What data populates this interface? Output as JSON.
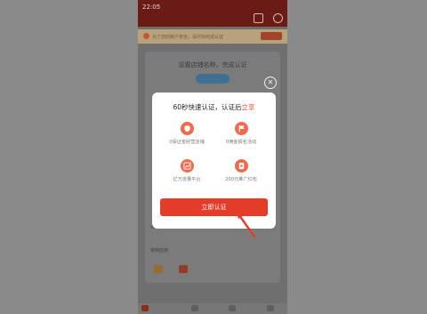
{
  "status_bar": {
    "time": "22:05"
  },
  "background": {
    "notice_text": "为了您的账户安全，请尽快完成认证",
    "heading": "设置店铺名称，完成认证",
    "link_row": "1分钟认证流程",
    "section_title": "常用应用"
  },
  "dialog": {
    "title_prefix": "60秒快速认证，认证后",
    "title_accent": "立享",
    "features": [
      {
        "label": "0保证金经营店铺",
        "icon": "shield-icon"
      },
      {
        "label": "0佣金报名活动",
        "icon": "flag-icon"
      },
      {
        "label": "亿万流量平台",
        "icon": "trend-chart-icon"
      },
      {
        "label": "200元推广红包",
        "icon": "red-packet-icon"
      }
    ],
    "cta_label": "立即认证"
  },
  "colors": {
    "accent": "#e53b29",
    "icon_bg": "#f06a4b",
    "overlay": "#8e8e8e",
    "title_accent": "#e94c35"
  }
}
